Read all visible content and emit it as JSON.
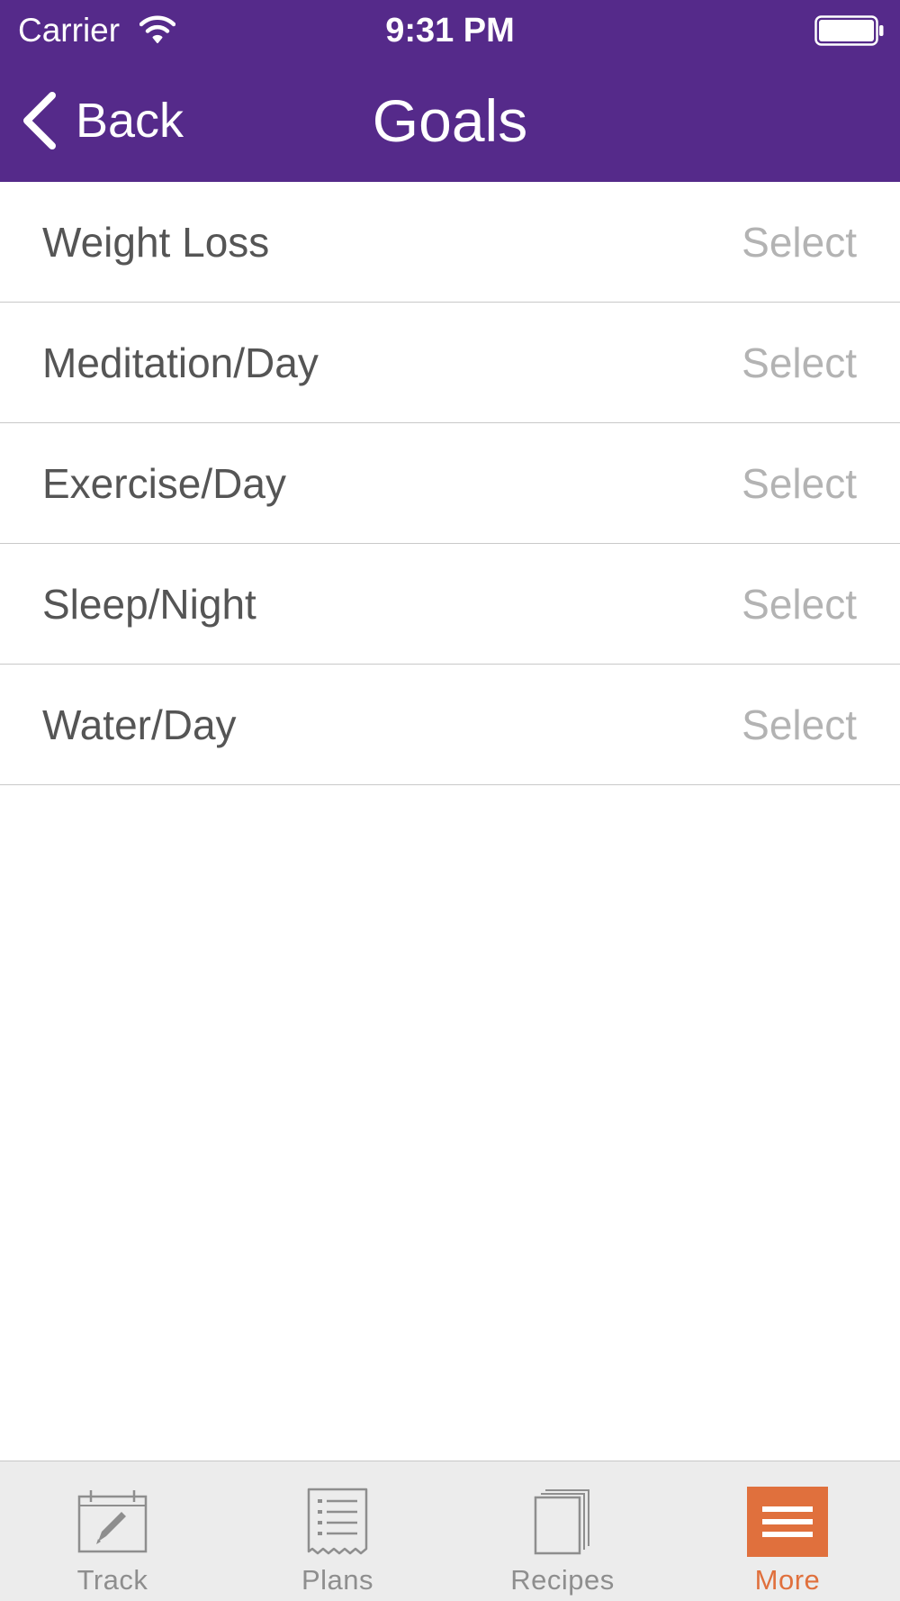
{
  "status_bar": {
    "carrier": "Carrier",
    "time": "9:31 PM",
    "wifi_icon": "wifi-icon",
    "battery_icon": "battery-icon"
  },
  "nav": {
    "back_label": "Back",
    "back_icon": "chevron-left-icon",
    "title": "Goals"
  },
  "goals": [
    {
      "label": "Weight Loss",
      "value": "Select"
    },
    {
      "label": "Meditation/Day",
      "value": "Select"
    },
    {
      "label": "Exercise/Day",
      "value": "Select"
    },
    {
      "label": "Sleep/Night",
      "value": "Select"
    },
    {
      "label": "Water/Day",
      "value": "Select"
    }
  ],
  "tabs": [
    {
      "label": "Track",
      "icon": "calendar-pencil-icon",
      "active": false
    },
    {
      "label": "Plans",
      "icon": "list-receipt-icon",
      "active": false
    },
    {
      "label": "Recipes",
      "icon": "book-stack-icon",
      "active": false
    },
    {
      "label": "More",
      "icon": "menu-lines-icon",
      "active": true
    }
  ],
  "colors": {
    "header_bg": "#552a8a",
    "accent": "#e0703d",
    "label_text": "#555555",
    "value_text": "#b3b3b3",
    "tab_inactive": "#8e8e8e",
    "tab_bar_bg": "#ececec"
  }
}
